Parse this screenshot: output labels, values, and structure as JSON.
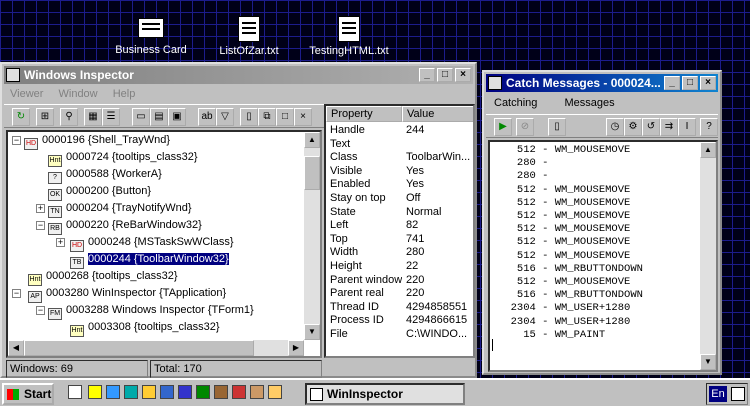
{
  "desktop": {
    "icons": [
      {
        "label": "Business Card"
      },
      {
        "label": "ListOfZar.txt"
      },
      {
        "label": "TestingHTML.txt"
      }
    ]
  },
  "inspector": {
    "title": "Windows Inspector",
    "menu": [
      "Viewer",
      "Window",
      "Help"
    ],
    "tree": [
      {
        "text": "0000196 {Shell_TrayWnd}",
        "icon": "HD"
      },
      {
        "text": "0000724 {tooltips_class32}",
        "icon": "Hnt"
      },
      {
        "text": "0000588 {WorkerA}",
        "icon": "?"
      },
      {
        "text": "0000200 {Button}",
        "icon": "OK"
      },
      {
        "text": "0000204 {TrayNotifyWnd}",
        "icon": "TN"
      },
      {
        "text": "0000220 {ReBarWindow32}",
        "icon": "RB"
      },
      {
        "text": "0000248 {MSTaskSwWClass}",
        "icon": "HD"
      },
      {
        "text": "0000244 {ToolbarWindow32}",
        "icon": "TB"
      },
      {
        "text": "0000268 {tooltips_class32}",
        "icon": "Hnt"
      },
      {
        "text": "0003280 WinInspector {TApplication}",
        "icon": "AP"
      },
      {
        "text": "0003288 Windows Inspector {TForm1}",
        "icon": "FM"
      },
      {
        "text": "0003308 {tooltips_class32}",
        "icon": "Hnt"
      }
    ],
    "props_header": {
      "property": "Property",
      "value": "Value"
    },
    "props": [
      {
        "p": "Handle",
        "v": "244"
      },
      {
        "p": "Text",
        "v": ""
      },
      {
        "p": "Class",
        "v": "ToolbarWin..."
      },
      {
        "p": "Visible",
        "v": "Yes"
      },
      {
        "p": "Enabled",
        "v": "Yes"
      },
      {
        "p": "Stay on top",
        "v": "Off"
      },
      {
        "p": "State",
        "v": "Normal"
      },
      {
        "p": "Left",
        "v": "82"
      },
      {
        "p": "Top",
        "v": "741"
      },
      {
        "p": "Width",
        "v": "280"
      },
      {
        "p": "Height",
        "v": "22"
      },
      {
        "p": "Parent window",
        "v": "220"
      },
      {
        "p": "Parent real",
        "v": "220"
      },
      {
        "p": "Thread ID",
        "v": "4294858551"
      },
      {
        "p": "Process ID",
        "v": "4294866615"
      },
      {
        "p": "File",
        "v": "C:\\WINDO..."
      }
    ],
    "status": {
      "windows": "Windows: 69",
      "total": "Total: 170"
    }
  },
  "catch": {
    "title": "Catch Messages - 000024...",
    "menu": [
      "Catching",
      "Messages"
    ],
    "messages": [
      "   512 - WM_MOUSEMOVE",
      "   280 -",
      "   280 -",
      "   512 - WM_MOUSEMOVE",
      "   512 - WM_MOUSEMOVE",
      "   512 - WM_MOUSEMOVE",
      "   512 - WM_MOUSEMOVE",
      "   512 - WM_MOUSEMOVE",
      "   512 - WM_MOUSEMOVE",
      "   516 - WM_RBUTTONDOWN",
      "   512 - WM_MOUSEMOVE",
      "   516 - WM_RBUTTONDOWN",
      "  2304 - WM_USER+1280",
      "  2304 - WM_USER+1280",
      "    15 - WM_PAINT"
    ]
  },
  "taskbar": {
    "start": "Start",
    "task": "WinInspector",
    "tray": "En"
  },
  "colors": {
    "title_active": "#000080",
    "title_active_end": "#1084d0",
    "title_inactive": "#808080",
    "desktop": "#000018"
  }
}
